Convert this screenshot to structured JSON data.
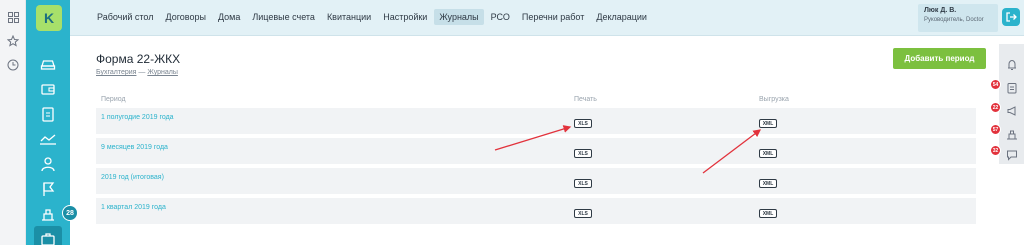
{
  "rail": {
    "icons": [
      "grid-icon",
      "star-icon",
      "clock-icon"
    ]
  },
  "sidebar": {
    "logo_letter": "K",
    "items": [
      "car-icon",
      "wallet-icon",
      "clipboard-icon",
      "chart-icon",
      "users-icon",
      "flag-icon",
      "building-icon",
      "briefcase-icon"
    ],
    "counter": "28"
  },
  "nav": {
    "items": [
      "Рабочий стол",
      "Договоры",
      "Дома",
      "Лицевые счета",
      "Квитанции",
      "Настройки",
      "Журналы",
      "РСО",
      "Перечни работ",
      "Декларации"
    ],
    "active": "Журналы"
  },
  "user": {
    "name": "Люк Д. В.",
    "role": "Руководитель, Doctor"
  },
  "page": {
    "title": "Форма 22-ЖКХ",
    "crumb1": "Бухгалтерия",
    "crumb_sep": "—",
    "crumb2": "Журналы",
    "add_button": "Добавить период"
  },
  "table": {
    "headers": [
      "Период",
      "Печать",
      "Выгрузка"
    ],
    "rows": [
      {
        "period": "1 полугодие 2019 года",
        "print": "XLS",
        "export": "XML"
      },
      {
        "period": "9 месяцев 2019 года",
        "print": "XLS",
        "export": "XML"
      },
      {
        "period": "2019 год (итоговая)",
        "print": "XLS",
        "export": "XML"
      },
      {
        "period": "1 квартал 2019 года",
        "print": "XLS",
        "export": "XML"
      }
    ]
  },
  "right_rail": {
    "items": [
      {
        "icon": "bell-icon",
        "badge": ""
      },
      {
        "icon": "clipboard-icon",
        "badge": "54"
      },
      {
        "icon": "megaphone-icon",
        "badge": "22"
      },
      {
        "icon": "building-icon",
        "badge": "57"
      },
      {
        "icon": "chat-icon",
        "badge": "32"
      }
    ]
  },
  "colors": {
    "teal": "#2bb3cc",
    "green": "#7cc03f",
    "red": "#e2323c",
    "logo": "#a7e06a"
  }
}
